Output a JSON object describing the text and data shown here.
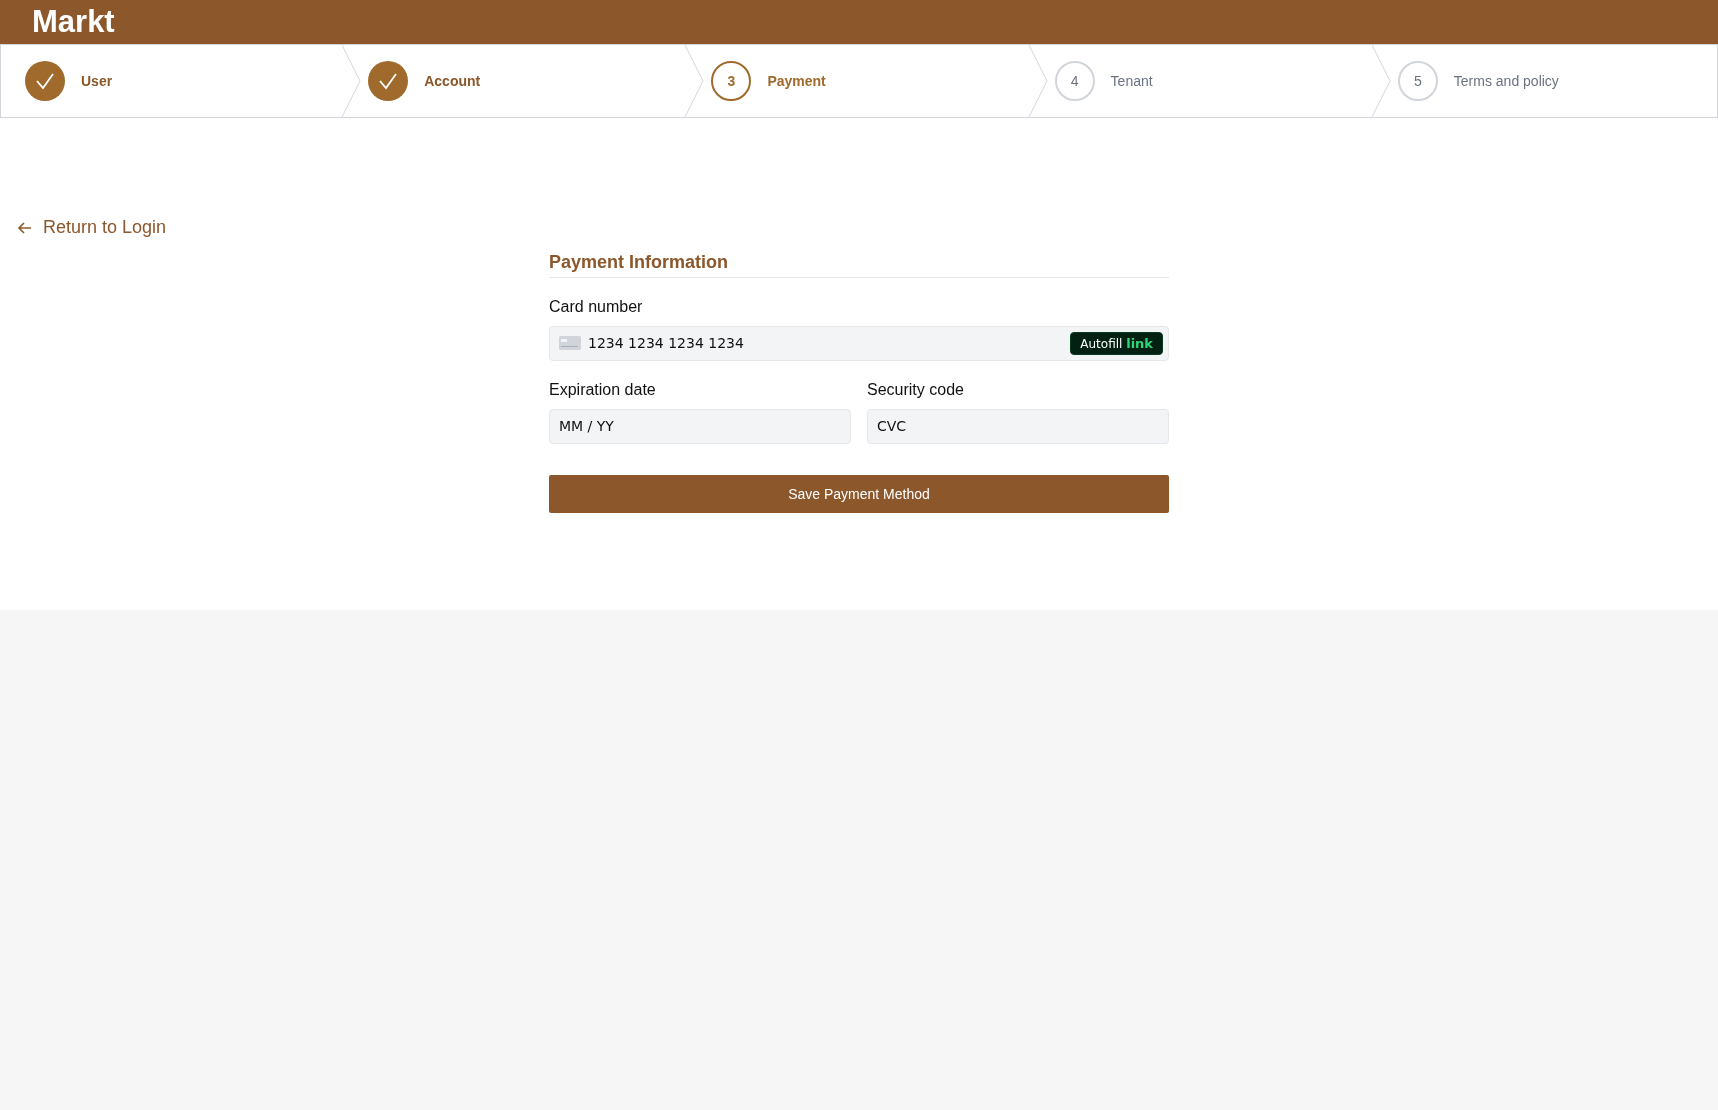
{
  "app": {
    "title": "Markt"
  },
  "steps": [
    {
      "label": "User",
      "completed": true,
      "selected": false
    },
    {
      "label": "Account",
      "completed": true,
      "selected": false
    },
    {
      "number": "3",
      "label": "Payment",
      "completed": false,
      "selected": true
    },
    {
      "number": "4",
      "label": "Tenant",
      "completed": false,
      "selected": false
    },
    {
      "number": "5",
      "label": "Terms and policy",
      "completed": false,
      "selected": false
    }
  ],
  "back_link": "Return to Login",
  "form": {
    "title": "Payment Information",
    "card_number": {
      "label": "Card number",
      "placeholder": "1234 1234 1234 1234",
      "autofill": {
        "label": "Autofill",
        "brand": "link"
      }
    },
    "expiration": {
      "label": "Expiration date",
      "placeholder": "MM / YY"
    },
    "security": {
      "label": "Security code",
      "placeholder": "CVC"
    },
    "submit": "Save Payment Method"
  }
}
